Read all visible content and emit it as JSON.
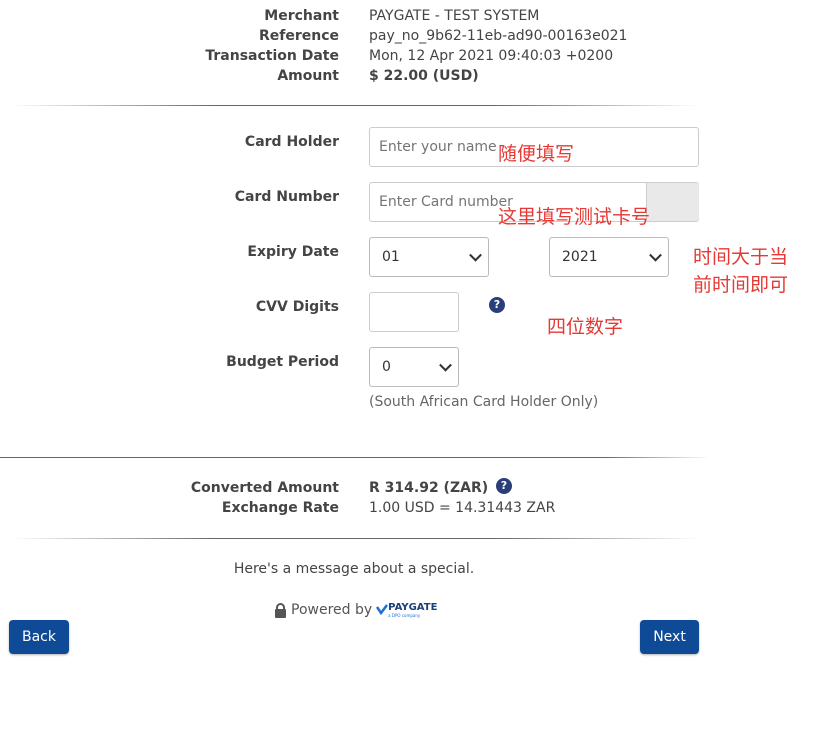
{
  "transaction": {
    "merchant_label": "Merchant",
    "merchant_value": "PAYGATE - TEST SYSTEM",
    "reference_label": "Reference",
    "reference_value": "pay_no_9b62-11eb-ad90-00163e021",
    "date_label": "Transaction Date",
    "date_value": "Mon, 12 Apr 2021 09:40:03 +0200",
    "amount_label": "Amount",
    "amount_value": "$ 22.00 (USD)"
  },
  "form": {
    "card_holder_label": "Card Holder",
    "card_holder_placeholder": "Enter your name",
    "card_number_label": "Card Number",
    "card_number_placeholder": "Enter Card number",
    "expiry_label": "Expiry Date",
    "expiry_month": "01",
    "expiry_year": "2021",
    "cvv_label": "CVV Digits",
    "cvv_value": "",
    "budget_label": "Budget Period",
    "budget_value": "0",
    "budget_note": "(South African Card Holder Only)"
  },
  "annotations": {
    "card_holder_note": "随便填写",
    "card_number_note": "这里填写测试卡号",
    "expiry_note_line1": "时间大于当",
    "expiry_note_line2": "前时间即可",
    "cvv_note": "四位数字"
  },
  "conversion": {
    "converted_label": "Converted Amount",
    "converted_value": "R 314.92 (ZAR)",
    "rate_label": "Exchange Rate",
    "rate_value": "1.00 USD = 14.31443 ZAR"
  },
  "footer": {
    "special_message": "Here's a message about a special.",
    "powered_by": "Powered by",
    "brand": "PAYGATE",
    "brand_sub": "a DPO company",
    "back_label": "Back",
    "next_label": "Next"
  },
  "icons": {
    "help": "question-circle-icon",
    "lock": "lock-icon",
    "help_glyph": "?"
  },
  "colors": {
    "primary": "#0f4a96",
    "annotation": "#e53935",
    "help_icon": "#2a3f7a"
  }
}
